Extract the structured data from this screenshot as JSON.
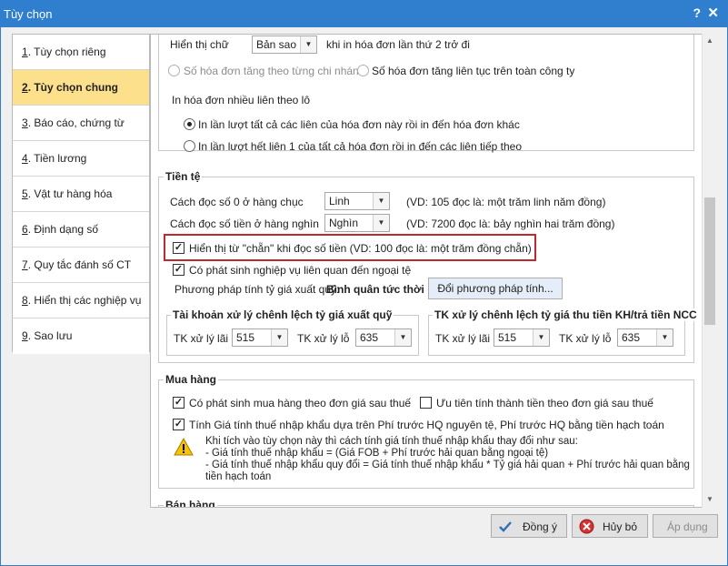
{
  "window": {
    "title": "Tùy chọn",
    "help": "?",
    "close": "✕"
  },
  "sidebar": {
    "items": [
      {
        "num": "1",
        "label": ". Tùy chọn riêng"
      },
      {
        "num": "2",
        "label": ". Tùy chọn chung"
      },
      {
        "num": "3",
        "label": ". Báo cáo, chứng từ"
      },
      {
        "num": "4",
        "label": ". Tiền lương"
      },
      {
        "num": "5",
        "label": ". Vật tư hàng hóa"
      },
      {
        "num": "6",
        "label": ". Định dạng số"
      },
      {
        "num": "7",
        "label": ". Quy tắc đánh số CT"
      },
      {
        "num": "8",
        "label": ". Hiển thị các nghiệp vụ"
      },
      {
        "num": "9",
        "label": ". Sao lưu"
      }
    ]
  },
  "invoice": {
    "display_label": "Hiển thị chữ",
    "display_value": "Bản sao",
    "display_suffix": "khi in hóa đơn lần thứ 2 trở đi",
    "radio_branch": "Số hóa đơn tăng theo từng chi nhánh",
    "radio_company": "Số hóa đơn tăng liên tục trên toàn công ty",
    "multi_print_label": "In hóa đơn nhiều liên theo lô",
    "radio_print_each": "In lần lượt tất cả các liên của hóa đơn này rồi in đến hóa đơn khác",
    "radio_print_all": "In lần lượt hết liên 1 của tất cả hóa đơn rồi in đến các liên tiếp theo"
  },
  "currency": {
    "title": "Tiền tệ",
    "zero_tens_label": "Cách đọc số 0 ở hàng chục",
    "zero_tens_value": "Linh",
    "zero_tens_example": "(VD: 105 đọc là: một trăm linh năm đồng)",
    "thousands_label": "Cách đọc số tiền ở hàng nghìn",
    "thousands_value": "Nghìn",
    "thousands_example": "(VD: 7200 đọc là: bảy nghìn hai trăm đồng)",
    "show_chan_label": "Hiển thị từ \"chẵn\" khi đọc số tiền (VD: 100 đọc là: một trăm đồng chẵn)",
    "foreign_label": "Có phát sinh nghiệp vụ liên quan đến ngoại tệ",
    "rate_method_label": "Phương pháp tính tỷ giá xuất quỹ:",
    "rate_method_value": "Bình quân tức thời",
    "change_method_button": "Đổi phương pháp tính...",
    "diff_group_title": "Tài khoản xử lý chênh lệch tỷ giá xuất quỹ",
    "diff_gain_label": "TK xử lý lãi",
    "diff_gain_value": "515",
    "diff_loss_label": "TK xử lý lỗ",
    "diff_loss_value": "635",
    "collect_group_title": "TK xử lý chênh lệch tỷ giá thu tiền KH/trả tiền NCC",
    "collect_gain_label": "TK xử lý lãi",
    "collect_gain_value": "515",
    "collect_loss_label": "TK xử lý lỗ",
    "collect_loss_value": "635"
  },
  "purchase": {
    "title": "Mua hàng",
    "after_tax_label": "Có phát sinh mua hàng theo đơn giá sau thuế",
    "priority_label": "Ưu tiên tính thành tiền theo đơn giá sau thuế",
    "import_tax_label": "Tính Giá tính thuế nhập khẩu dựa trên Phí trước HQ nguyên tệ, Phí trước HQ bằng tiền hạch toán",
    "warn_line1": "Khi tích vào tùy chọn này thì cách tính giá tính thuế nhập khẩu thay đổi như sau:",
    "warn_line2": "- Giá tính thuế nhập khẩu = (Giá FOB + Phí trước hải quan bằng ngoại tệ)",
    "warn_line3": "- Giá tính thuế nhập khẩu quy đổi = Giá tính thuế nhập khẩu * Tỷ giá hải quan + Phí trước hải quan bằng",
    "warn_line4": "tiền hạch toán"
  },
  "sales": {
    "title": "Bán hàng"
  },
  "footer": {
    "ok": "Đồng ý",
    "cancel": "Hủy bỏ",
    "apply": "Áp dụng"
  },
  "colors": {
    "titlebar": "#2f7fce",
    "active_nav": "#fde08b",
    "highlight_border": "#c0282d"
  }
}
